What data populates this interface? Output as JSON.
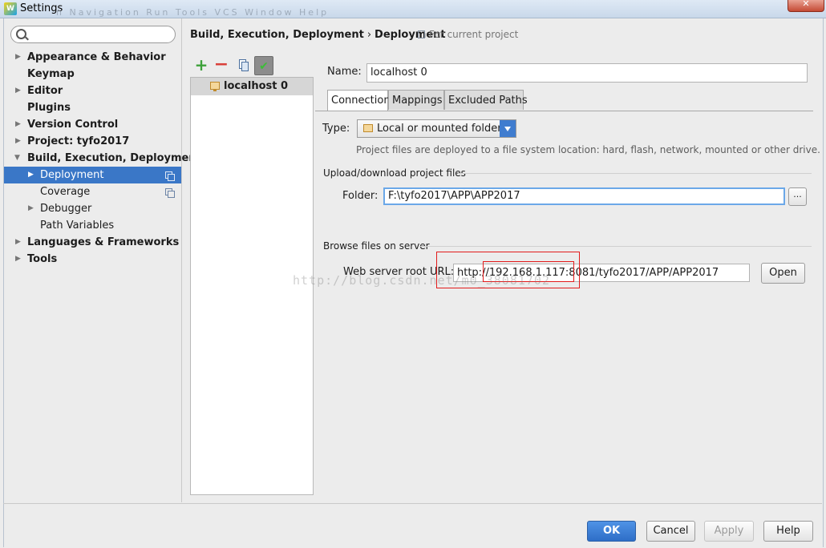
{
  "window": {
    "title": "Settings",
    "ghost_menu": "n  Navigation  Run  Tools  VCS  Window  Help"
  },
  "search": {
    "value": "",
    "placeholder": ""
  },
  "tree": {
    "items": [
      {
        "label": "Appearance & Behavior"
      },
      {
        "label": "Keymap"
      },
      {
        "label": "Editor"
      },
      {
        "label": "Plugins"
      },
      {
        "label": "Version Control"
      },
      {
        "label": "Project: tyfo2017"
      },
      {
        "label": "Build, Execution, Deployment"
      },
      {
        "label": "Deployment"
      },
      {
        "label": "Coverage"
      },
      {
        "label": "Debugger"
      },
      {
        "label": "Path Variables"
      },
      {
        "label": "Languages & Frameworks"
      },
      {
        "label": "Tools"
      }
    ]
  },
  "breadcrumb": {
    "parent": "Build, Execution, Deployment",
    "separator": "›",
    "current": "Deployment",
    "scope": "For current project"
  },
  "servers": {
    "items": [
      {
        "label": "localhost 0"
      }
    ]
  },
  "form": {
    "name_label": "Name:",
    "name_value": "localhost 0",
    "tabs": [
      "Connection",
      "Mappings",
      "Excluded Paths"
    ],
    "type_label": "Type:",
    "type_value": "Local or mounted folder",
    "type_hint": "Project files are deployed to a file system location: hard, flash, network, mounted or other drive.",
    "upload_section": "Upload/download project files",
    "folder_label": "Folder:",
    "folder_value": "F:\\tyfo2017\\APP\\APP2017",
    "browse_label": "...",
    "browse_section": "Browse files on server",
    "url_label": "Web server root URL:",
    "url_value": "http://192.168.1.117:8081/tyfo2017/APP/APP2017",
    "open_label": "Open"
  },
  "watermark": "http://blog.csdn.net/m0_38081702",
  "footer": {
    "ok": "OK",
    "cancel": "Cancel",
    "apply": "Apply",
    "help": "Help"
  },
  "colors": {
    "accent": "#3a77c7",
    "highlight": "#e21b1b"
  }
}
